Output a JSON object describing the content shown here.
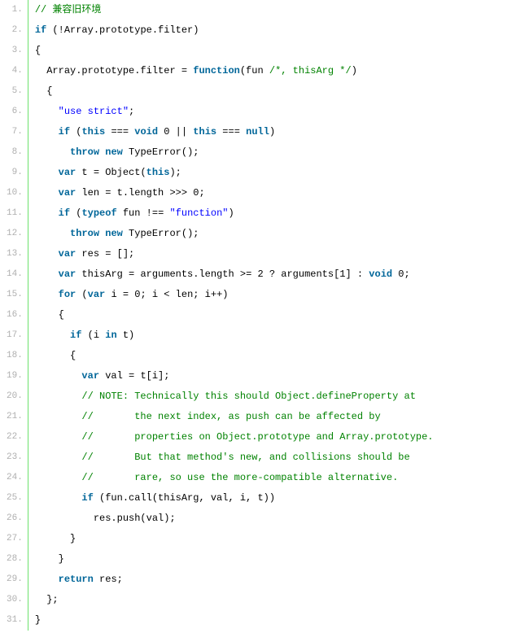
{
  "lines": [
    {
      "num": "1.",
      "tokens": [
        {
          "t": "cm",
          "v": "// 兼容旧环境"
        }
      ]
    },
    {
      "num": "2.",
      "tokens": [
        {
          "t": "kw",
          "v": "if"
        },
        {
          "t": "pln",
          "v": " (!Array.prototype.filter)"
        }
      ]
    },
    {
      "num": "3.",
      "tokens": [
        {
          "t": "pln",
          "v": "{"
        }
      ]
    },
    {
      "num": "4.",
      "tokens": [
        {
          "t": "pln",
          "v": "  Array.prototype.filter = "
        },
        {
          "t": "kw",
          "v": "function"
        },
        {
          "t": "pln",
          "v": "(fun "
        },
        {
          "t": "cm",
          "v": "/*, thisArg */"
        },
        {
          "t": "pln",
          "v": ")"
        }
      ]
    },
    {
      "num": "5.",
      "tokens": [
        {
          "t": "pln",
          "v": "  {"
        }
      ]
    },
    {
      "num": "6.",
      "tokens": [
        {
          "t": "pln",
          "v": "    "
        },
        {
          "t": "str",
          "v": "\"use strict\""
        },
        {
          "t": "pln",
          "v": ";"
        }
      ]
    },
    {
      "num": "7.",
      "tokens": [
        {
          "t": "pln",
          "v": "    "
        },
        {
          "t": "kw",
          "v": "if"
        },
        {
          "t": "pln",
          "v": " ("
        },
        {
          "t": "kw",
          "v": "this"
        },
        {
          "t": "pln",
          "v": " === "
        },
        {
          "t": "kw",
          "v": "void"
        },
        {
          "t": "pln",
          "v": " 0 || "
        },
        {
          "t": "kw",
          "v": "this"
        },
        {
          "t": "pln",
          "v": " === "
        },
        {
          "t": "kw",
          "v": "null"
        },
        {
          "t": "pln",
          "v": ")"
        }
      ]
    },
    {
      "num": "8.",
      "tokens": [
        {
          "t": "pln",
          "v": "      "
        },
        {
          "t": "kw",
          "v": "throw"
        },
        {
          "t": "pln",
          "v": " "
        },
        {
          "t": "kw",
          "v": "new"
        },
        {
          "t": "pln",
          "v": " TypeError();"
        }
      ]
    },
    {
      "num": "9.",
      "tokens": [
        {
          "t": "pln",
          "v": "    "
        },
        {
          "t": "kw",
          "v": "var"
        },
        {
          "t": "pln",
          "v": " t = Object("
        },
        {
          "t": "kw",
          "v": "this"
        },
        {
          "t": "pln",
          "v": ");"
        }
      ]
    },
    {
      "num": "10.",
      "tokens": [
        {
          "t": "pln",
          "v": "    "
        },
        {
          "t": "kw",
          "v": "var"
        },
        {
          "t": "pln",
          "v": " len = t.length >>> 0;"
        }
      ]
    },
    {
      "num": "11.",
      "tokens": [
        {
          "t": "pln",
          "v": "    "
        },
        {
          "t": "kw",
          "v": "if"
        },
        {
          "t": "pln",
          "v": " ("
        },
        {
          "t": "kw",
          "v": "typeof"
        },
        {
          "t": "pln",
          "v": " fun !== "
        },
        {
          "t": "str",
          "v": "\"function\""
        },
        {
          "t": "pln",
          "v": ")"
        }
      ]
    },
    {
      "num": "12.",
      "tokens": [
        {
          "t": "pln",
          "v": "      "
        },
        {
          "t": "kw",
          "v": "throw"
        },
        {
          "t": "pln",
          "v": " "
        },
        {
          "t": "kw",
          "v": "new"
        },
        {
          "t": "pln",
          "v": " TypeError();"
        }
      ]
    },
    {
      "num": "13.",
      "tokens": [
        {
          "t": "pln",
          "v": "    "
        },
        {
          "t": "kw",
          "v": "var"
        },
        {
          "t": "pln",
          "v": " res = [];"
        }
      ]
    },
    {
      "num": "14.",
      "tokens": [
        {
          "t": "pln",
          "v": "    "
        },
        {
          "t": "kw",
          "v": "var"
        },
        {
          "t": "pln",
          "v": " thisArg = arguments.length >= 2 ? arguments[1] : "
        },
        {
          "t": "kw",
          "v": "void"
        },
        {
          "t": "pln",
          "v": " 0;"
        }
      ]
    },
    {
      "num": "15.",
      "tokens": [
        {
          "t": "pln",
          "v": "    "
        },
        {
          "t": "kw",
          "v": "for"
        },
        {
          "t": "pln",
          "v": " ("
        },
        {
          "t": "kw",
          "v": "var"
        },
        {
          "t": "pln",
          "v": " i = 0; i < len; i++)"
        }
      ]
    },
    {
      "num": "16.",
      "tokens": [
        {
          "t": "pln",
          "v": "    {"
        }
      ]
    },
    {
      "num": "17.",
      "tokens": [
        {
          "t": "pln",
          "v": "      "
        },
        {
          "t": "kw",
          "v": "if"
        },
        {
          "t": "pln",
          "v": " (i "
        },
        {
          "t": "kw",
          "v": "in"
        },
        {
          "t": "pln",
          "v": " t)"
        }
      ]
    },
    {
      "num": "18.",
      "tokens": [
        {
          "t": "pln",
          "v": "      {"
        }
      ]
    },
    {
      "num": "19.",
      "tokens": [
        {
          "t": "pln",
          "v": "        "
        },
        {
          "t": "kw",
          "v": "var"
        },
        {
          "t": "pln",
          "v": " val = t[i];"
        }
      ]
    },
    {
      "num": "20.",
      "tokens": [
        {
          "t": "pln",
          "v": "        "
        },
        {
          "t": "cm",
          "v": "// NOTE: Technically this should Object.defineProperty at"
        }
      ]
    },
    {
      "num": "21.",
      "tokens": [
        {
          "t": "pln",
          "v": "        "
        },
        {
          "t": "cm",
          "v": "//       the next index, as push can be affected by"
        }
      ]
    },
    {
      "num": "22.",
      "tokens": [
        {
          "t": "pln",
          "v": "        "
        },
        {
          "t": "cm",
          "v": "//       properties on Object.prototype and Array.prototype."
        }
      ]
    },
    {
      "num": "23.",
      "tokens": [
        {
          "t": "pln",
          "v": "        "
        },
        {
          "t": "cm",
          "v": "//       But that method's new, and collisions should be"
        }
      ]
    },
    {
      "num": "24.",
      "tokens": [
        {
          "t": "pln",
          "v": "        "
        },
        {
          "t": "cm",
          "v": "//       rare, so use the more-compatible alternative."
        }
      ]
    },
    {
      "num": "25.",
      "tokens": [
        {
          "t": "pln",
          "v": "        "
        },
        {
          "t": "kw",
          "v": "if"
        },
        {
          "t": "pln",
          "v": " (fun.call(thisArg, val, i, t))"
        }
      ]
    },
    {
      "num": "26.",
      "tokens": [
        {
          "t": "pln",
          "v": "          res.push(val);"
        }
      ]
    },
    {
      "num": "27.",
      "tokens": [
        {
          "t": "pln",
          "v": "      }"
        }
      ]
    },
    {
      "num": "28.",
      "tokens": [
        {
          "t": "pln",
          "v": "    }"
        }
      ]
    },
    {
      "num": "29.",
      "tokens": [
        {
          "t": "pln",
          "v": "    "
        },
        {
          "t": "kw",
          "v": "return"
        },
        {
          "t": "pln",
          "v": " res;"
        }
      ]
    },
    {
      "num": "30.",
      "tokens": [
        {
          "t": "pln",
          "v": "  };"
        }
      ]
    },
    {
      "num": "31.",
      "tokens": [
        {
          "t": "pln",
          "v": "}"
        }
      ]
    }
  ]
}
